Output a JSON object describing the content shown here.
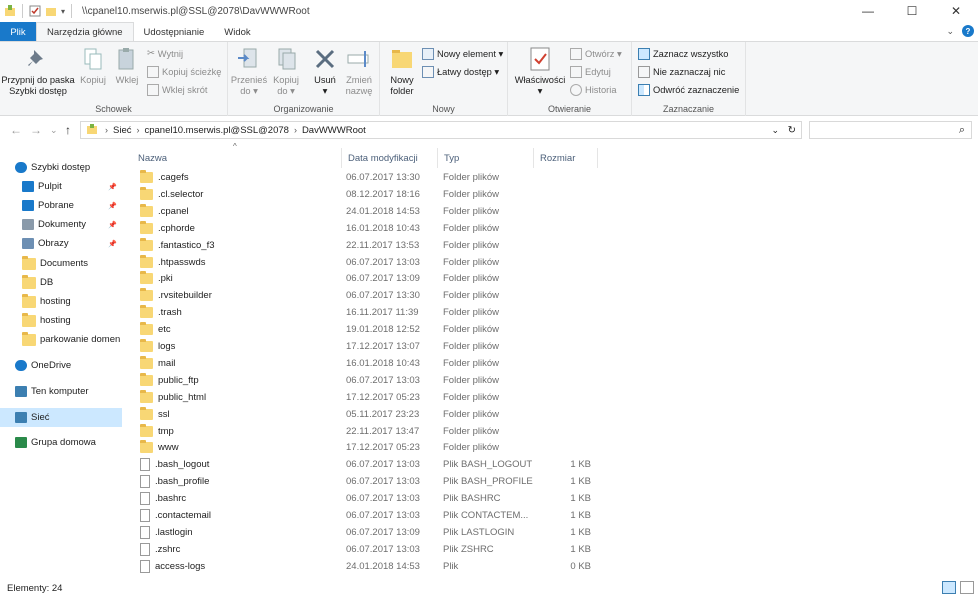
{
  "window": {
    "title": "\\\\cpanel10.mserwis.pl@SSL@2078\\DavWWWRoot",
    "buttons": {
      "minimize": "—",
      "maximize": "☐",
      "close": "✕"
    }
  },
  "ribbon_tabs": [
    {
      "label": "Plik"
    },
    {
      "label": "Narzędzia główne"
    },
    {
      "label": "Udostępnianie"
    },
    {
      "label": "Widok"
    }
  ],
  "help_label": "?",
  "ribbon": {
    "schowek": {
      "label": "Schowek",
      "pin": "Przypnij do paska\nSzybki dostęp",
      "copy": "Kopiuj",
      "paste": "Wklej",
      "cut": "Wytnij",
      "copy_path": "Kopiuj ścieżkę",
      "paste_shortcut": "Wklej skrót"
    },
    "organizowanie": {
      "label": "Organizowanie",
      "move_to": "Przenieś\ndo ▾",
      "copy_to": "Kopiuj\ndo ▾",
      "delete": "Usuń\n▾",
      "rename": "Zmień\nnazwę"
    },
    "nowy": {
      "label": "Nowy",
      "new_folder": "Nowy\nfolder",
      "new_item": "Nowy element ▾",
      "easy_access": "Łatwy dostęp ▾"
    },
    "otwieranie": {
      "label": "Otwieranie",
      "properties": "Właściwości\n▾",
      "open": "Otwórz ▾",
      "edit": "Edytuj",
      "history": "Historia"
    },
    "zaznaczanie": {
      "label": "Zaznaczanie",
      "select_all": "Zaznacz wszystko",
      "select_none": "Nie zaznaczaj nic",
      "invert": "Odwróć zaznaczenie"
    }
  },
  "address": {
    "crumbs": [
      "Sieć",
      "cpanel10.mserwis.pl@SSL@2078",
      "DavWWWRoot"
    ],
    "search_icon": "⌕"
  },
  "nav": [
    {
      "label": "Szybki dostęp",
      "icon": "star-icon",
      "pinned": false,
      "indent": false
    },
    {
      "label": "Pulpit",
      "icon": "desktop-icon",
      "pinned": true,
      "indent": true
    },
    {
      "label": "Pobrane",
      "icon": "download-icon",
      "pinned": true,
      "indent": true
    },
    {
      "label": "Dokumenty",
      "icon": "documents-icon",
      "pinned": true,
      "indent": true
    },
    {
      "label": "Obrazy",
      "icon": "pictures-icon",
      "pinned": true,
      "indent": true
    },
    {
      "label": "Documents",
      "icon": "folder-icon",
      "pinned": false,
      "indent": true
    },
    {
      "label": "DB",
      "icon": "folder-icon",
      "pinned": false,
      "indent": true
    },
    {
      "label": "hosting",
      "icon": "folder-icon",
      "pinned": false,
      "indent": true
    },
    {
      "label": "hosting",
      "icon": "folder-icon",
      "pinned": false,
      "indent": true
    },
    {
      "label": "parkowanie domen",
      "icon": "folder-icon",
      "pinned": false,
      "indent": true
    },
    {
      "label": "OneDrive",
      "icon": "cloud-icon",
      "pinned": false,
      "indent": false
    },
    {
      "label": "Ten komputer",
      "icon": "computer-icon",
      "pinned": false,
      "indent": false
    },
    {
      "label": "Sieć",
      "icon": "network-icon",
      "pinned": false,
      "indent": false,
      "selected": true
    },
    {
      "label": "Grupa domowa",
      "icon": "homegroup-icon",
      "pinned": false,
      "indent": false
    }
  ],
  "columns": {
    "name": "Nazwa",
    "date": "Data modyfikacji",
    "type": "Typ",
    "size": "Rozmiar"
  },
  "files": [
    {
      "name": ".cagefs",
      "date": "06.07.2017 13:30",
      "type": "Folder plików",
      "size": "",
      "kind": "folder"
    },
    {
      "name": ".cl.selector",
      "date": "08.12.2017 18:16",
      "type": "Folder plików",
      "size": "",
      "kind": "folder"
    },
    {
      "name": ".cpanel",
      "date": "24.01.2018 14:53",
      "type": "Folder plików",
      "size": "",
      "kind": "folder"
    },
    {
      "name": ".cphorde",
      "date": "16.01.2018 10:43",
      "type": "Folder plików",
      "size": "",
      "kind": "folder"
    },
    {
      "name": ".fantastico_f3",
      "date": "22.11.2017 13:53",
      "type": "Folder plików",
      "size": "",
      "kind": "folder"
    },
    {
      "name": ".htpasswds",
      "date": "06.07.2017 13:03",
      "type": "Folder plików",
      "size": "",
      "kind": "folder"
    },
    {
      "name": ".pki",
      "date": "06.07.2017 13:09",
      "type": "Folder plików",
      "size": "",
      "kind": "folder"
    },
    {
      "name": ".rvsitebuilder",
      "date": "06.07.2017 13:30",
      "type": "Folder plików",
      "size": "",
      "kind": "folder"
    },
    {
      "name": ".trash",
      "date": "16.11.2017 11:39",
      "type": "Folder plików",
      "size": "",
      "kind": "folder"
    },
    {
      "name": "etc",
      "date": "19.01.2018 12:52",
      "type": "Folder plików",
      "size": "",
      "kind": "folder"
    },
    {
      "name": "logs",
      "date": "17.12.2017 13:07",
      "type": "Folder plików",
      "size": "",
      "kind": "folder"
    },
    {
      "name": "mail",
      "date": "16.01.2018 10:43",
      "type": "Folder plików",
      "size": "",
      "kind": "folder"
    },
    {
      "name": "public_ftp",
      "date": "06.07.2017 13:03",
      "type": "Folder plików",
      "size": "",
      "kind": "folder"
    },
    {
      "name": "public_html",
      "date": "17.12.2017 05:23",
      "type": "Folder plików",
      "size": "",
      "kind": "folder"
    },
    {
      "name": "ssl",
      "date": "05.11.2017 23:23",
      "type": "Folder plików",
      "size": "",
      "kind": "folder"
    },
    {
      "name": "tmp",
      "date": "22.11.2017 13:47",
      "type": "Folder plików",
      "size": "",
      "kind": "folder"
    },
    {
      "name": "www",
      "date": "17.12.2017 05:23",
      "type": "Folder plików",
      "size": "",
      "kind": "folder"
    },
    {
      "name": ".bash_logout",
      "date": "06.07.2017 13:03",
      "type": "Plik BASH_LOGOUT",
      "size": "1 KB",
      "kind": "file"
    },
    {
      "name": ".bash_profile",
      "date": "06.07.2017 13:03",
      "type": "Plik BASH_PROFILE",
      "size": "1 KB",
      "kind": "file"
    },
    {
      "name": ".bashrc",
      "date": "06.07.2017 13:03",
      "type": "Plik BASHRC",
      "size": "1 KB",
      "kind": "file"
    },
    {
      "name": ".contactemail",
      "date": "06.07.2017 13:03",
      "type": "Plik CONTACTEM...",
      "size": "1 KB",
      "kind": "file"
    },
    {
      "name": ".lastlogin",
      "date": "06.07.2017 13:09",
      "type": "Plik LASTLOGIN",
      "size": "1 KB",
      "kind": "file"
    },
    {
      "name": ".zshrc",
      "date": "06.07.2017 13:03",
      "type": "Plik ZSHRC",
      "size": "1 KB",
      "kind": "file"
    },
    {
      "name": "access-logs",
      "date": "24.01.2018 14:53",
      "type": "Plik",
      "size": "0 KB",
      "kind": "file"
    }
  ],
  "status": {
    "text": "Elementy: 24"
  },
  "colors": {
    "accent": "#1979ca",
    "selection": "#cce8ff",
    "folder": "#f8d775"
  }
}
